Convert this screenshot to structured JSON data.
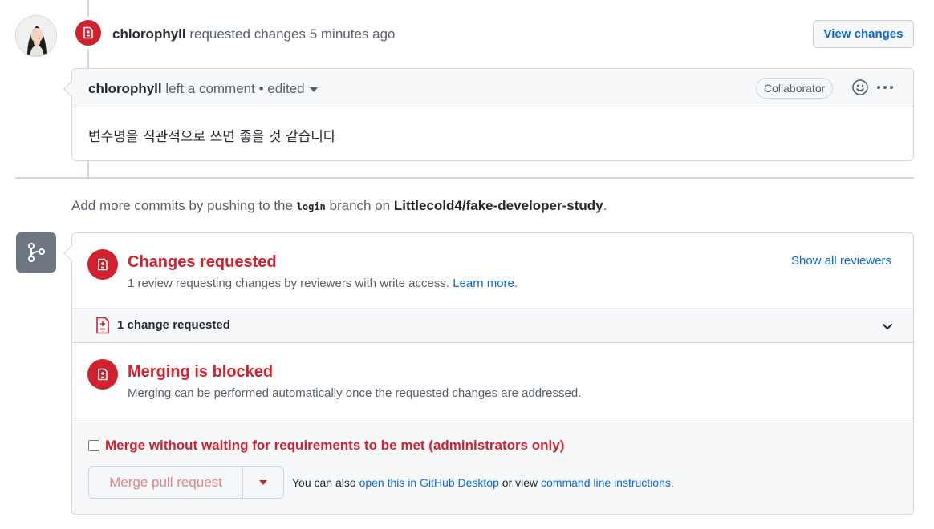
{
  "review_event": {
    "author": "chlorophyll",
    "action": "requested changes",
    "time": "5 minutes ago",
    "view_changes_label": "View changes"
  },
  "comment": {
    "author": "chlorophyll",
    "left_text": "left a comment",
    "separator": "•",
    "edited_label": "edited",
    "role_badge": "Collaborator",
    "body": "변수명을 직관적으로 쓰면 좋을 것 같습니다"
  },
  "commit_hint": {
    "prefix": "Add more commits by pushing to the",
    "branch": "login",
    "middle": "branch on",
    "repo": "Littlecold4/fake-developer-study",
    "suffix": "."
  },
  "merge_box": {
    "changes_requested": {
      "title": "Changes requested",
      "desc": "1 review requesting changes by reviewers with write access.",
      "learn_more": "Learn more.",
      "show_all_reviewers": "Show all reviewers"
    },
    "change_row_label": "1 change requested",
    "blocked": {
      "title": "Merging is blocked",
      "desc": "Merging can be performed automatically once the requested changes are addressed."
    },
    "admin_checkbox_label": "Merge without waiting for requirements to be met (administrators only)",
    "merge_button_label": "Merge pull request",
    "alt": {
      "prefix": "You can also",
      "desktop_link": "open this in GitHub Desktop",
      "middle": "or view",
      "cli_link": "command line instructions",
      "suffix": "."
    }
  },
  "colors": {
    "danger": "#cf222e",
    "link": "#0969da",
    "muted": "#57606a",
    "neutral_icon_bg": "#6e7781"
  },
  "icons": [
    "file-diff-icon",
    "smiley-icon",
    "kebab-icon",
    "git-branch-icon",
    "chevron-down-icon",
    "caret-down-icon"
  ]
}
